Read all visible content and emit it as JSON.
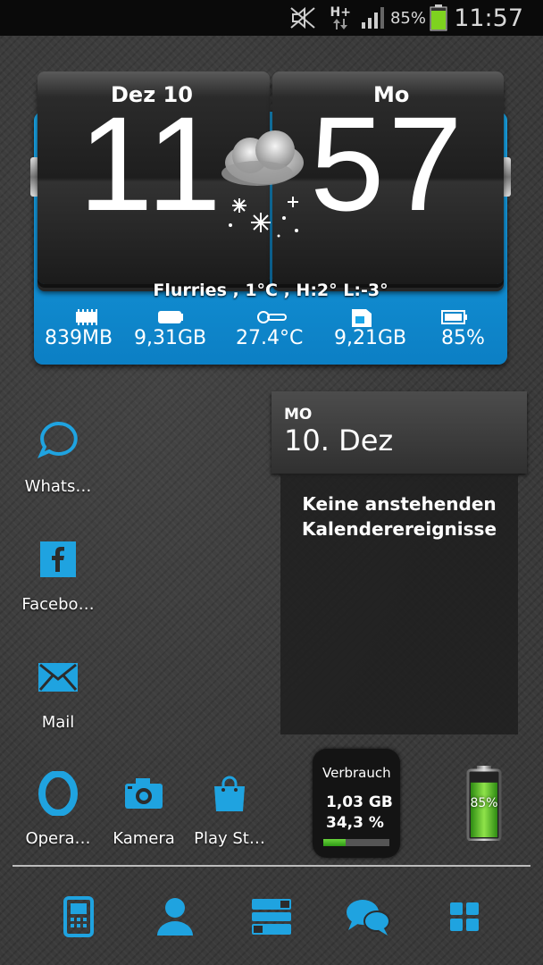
{
  "status_bar": {
    "network_type": "H+",
    "battery_percent": "85%",
    "time": "11:57",
    "icons": [
      "mute-icon",
      "data-activity-icon",
      "signal-icon",
      "battery-icon"
    ]
  },
  "clock_widget": {
    "date_label": "Dez  10",
    "day_label": "Mo",
    "hour": "11",
    "minute": "57",
    "weather_icon": "snow-cloud-icon",
    "weather_text": "Flurries , 1°C , H:2° L:-3°",
    "stats": {
      "ram": "839MB",
      "internal_storage": "9,31GB",
      "temperature": "27.4°C",
      "sd_storage": "9,21GB",
      "battery": "85%"
    },
    "accent_color": "#1aa6e8"
  },
  "apps": [
    {
      "label": "Whats…",
      "icon": "chat-bubble-icon"
    },
    {
      "label": "Facebo…",
      "icon": "facebook-icon"
    },
    {
      "label": "Mail",
      "icon": "mail-icon"
    },
    {
      "label": "Opera…",
      "icon": "opera-icon"
    },
    {
      "label": "Kamera",
      "icon": "camera-icon"
    },
    {
      "label": "Play St…",
      "icon": "shopping-bag-icon"
    }
  ],
  "calendar_widget": {
    "day_of_week": "MO",
    "date": "10. Dez",
    "empty_message_line1": "Keine anstehenden",
    "empty_message_line2": "Kalenderereignisse"
  },
  "data_widget": {
    "title": "Verbrauch",
    "amount": "1,03 GB",
    "percent": "34,3 %",
    "fill_fraction": 0.343
  },
  "battery_widget": {
    "percent": "85%",
    "fill_fraction": 0.85
  },
  "dock": [
    "phone-icon",
    "contacts-icon",
    "notes-icon",
    "messages-icon",
    "app-drawer-icon"
  ],
  "icon_color": "#1fa3e0"
}
